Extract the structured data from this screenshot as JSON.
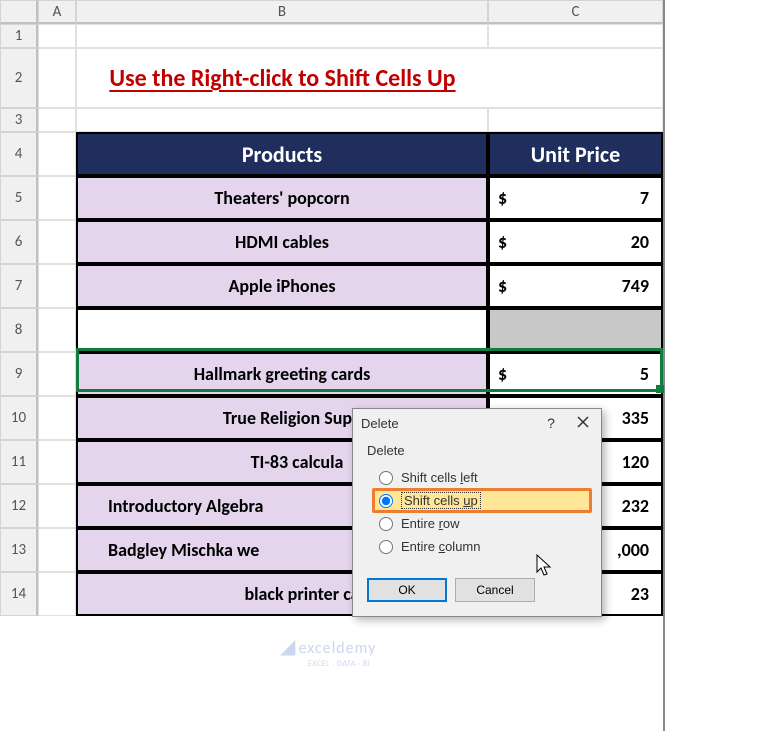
{
  "columns": [
    "A",
    "B",
    "C"
  ],
  "rows": [
    "1",
    "2",
    "3",
    "4",
    "5",
    "6",
    "7",
    "8",
    "9",
    "10",
    "11",
    "12",
    "13",
    "14"
  ],
  "title": "Use the Right-click to Shift Cells Up",
  "table": {
    "headers": {
      "products": "Products",
      "price": "Unit Price"
    },
    "rows": [
      {
        "product": "Theaters' popcorn",
        "price": "7"
      },
      {
        "product": "HDMI cables",
        "price": "20"
      },
      {
        "product": "Apple iPhones",
        "price": "749"
      },
      {
        "product": "",
        "price": ""
      },
      {
        "product": "Hallmark greeting cards",
        "price": "5"
      },
      {
        "product": "True Religion Supe",
        "price": "335"
      },
      {
        "product": "TI-83 calcula",
        "price": "120"
      },
      {
        "product": "Introductory Algebra",
        "price": "232"
      },
      {
        "product": "Badgley Mischka we",
        "price": ",000"
      },
      {
        "product": "black printer ca",
        "price": "23"
      }
    ]
  },
  "dialog": {
    "title": "Delete",
    "group_label": "Delete",
    "options": {
      "left": "Shift cells left",
      "up": "Shift cells up",
      "row": "Entire row",
      "col": "Entire column"
    },
    "buttons": {
      "ok": "OK",
      "cancel": "Cancel"
    }
  },
  "watermark": {
    "text": "exceldemy",
    "sub": "EXCEL · DATA · BI"
  },
  "currency": "$"
}
